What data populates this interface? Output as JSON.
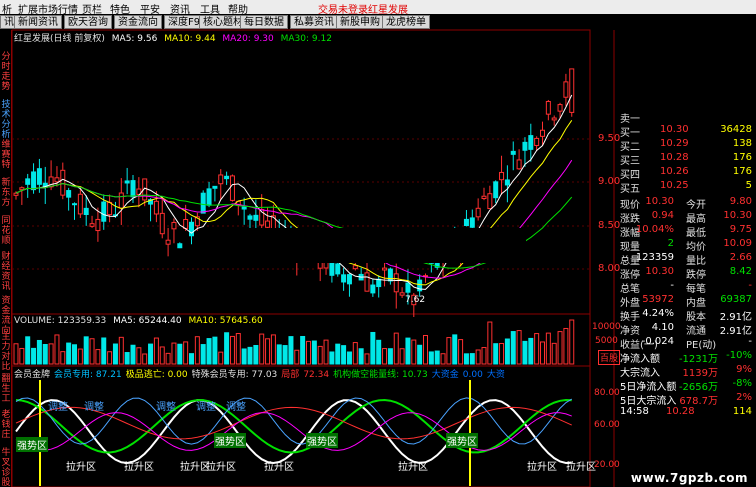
{
  "menubar": {
    "items": [
      "析",
      "扩展市场行情",
      "页栏",
      "特色",
      "平安",
      "资讯",
      "工具",
      "帮助"
    ],
    "right_items": [
      "交易未登录",
      "红星发展"
    ]
  },
  "tabs": [
    "讯",
    "新闻资讯",
    "欧天咨询",
    "资金流向",
    "深度F9",
    "核心题材",
    "每日数据",
    "私募资讯",
    "新股申购",
    "龙虎榜单"
  ],
  "sidebar": {
    "items": [
      "分时走势",
      "技术分析",
      "维赛特",
      "新东方",
      "同花顺",
      "财经资讯",
      "资金流向",
      "主力对比",
      "翻生工",
      "老钱庄",
      "牛叉诊股"
    ]
  },
  "kline": {
    "title": "红星发展(日线 前复权)",
    "ma5": "MA5: 9.56",
    "ma10": "MA10: 9.44",
    "ma20": "MA20: 9.30",
    "ma30": "MA30: 9.12",
    "low_label": "7.62",
    "axis": [
      "9.50",
      "9.00",
      "8.50",
      "8.00"
    ]
  },
  "volume": {
    "label": "VOLUME: 123359.33",
    "ma5": "MA5: 65244.40",
    "ma10": "MA10: 57645.60",
    "axis": [
      "10000",
      "5000"
    ],
    "unit": "百股"
  },
  "indicator": {
    "items": [
      {
        "text": "会员金牌",
        "color": "#e0e0e0"
      },
      {
        "text": "会员专用: 87.21",
        "color": "#00c0ff"
      },
      {
        "text": "极品逃亡: 0.00",
        "color": "#ffff00"
      },
      {
        "text": "特殊会员专用: 77.03",
        "color": "#e0e0e0"
      },
      {
        "text": "局部",
        "color": "#ff3030"
      },
      {
        "text": "72.34",
        "color": "#ff3030"
      },
      {
        "text": "机构做空能量线: 10.73",
        "color": "#00e000"
      },
      {
        "text": "大资金",
        "color": "#0070ff"
      },
      {
        "text": "0.00",
        "color": "#0070ff"
      },
      {
        "text": "大资",
        "color": "#0070ff"
      }
    ],
    "axis": [
      "80.00",
      "60.00",
      "20.00"
    ],
    "labels_lashen": "拉升区",
    "labels_qiangshi": "强势区",
    "labels_tiaozheng": "调整"
  },
  "quote": {
    "rows": [
      {
        "label": "卖一",
        "price": "",
        "vol": ""
      },
      {
        "label": "买一",
        "price": "10.30",
        "vol": "36428"
      },
      {
        "label": "买二",
        "price": "10.29",
        "vol": "138"
      },
      {
        "label": "买三",
        "price": "10.28",
        "vol": "176"
      },
      {
        "label": "买四",
        "price": "10.26",
        "vol": "176"
      },
      {
        "label": "买五",
        "price": "10.25",
        "vol": "5"
      }
    ],
    "stats": [
      [
        "现价",
        "10.30",
        "今开",
        "9.80"
      ],
      [
        "涨跌",
        "0.94",
        "最高",
        "10.30"
      ],
      [
        "涨幅",
        "10.04%",
        "最低",
        "9.75"
      ],
      [
        "现量",
        "2",
        "均价",
        "10.09"
      ],
      [
        "总量",
        "123359",
        "量比",
        "2.66"
      ],
      [
        "涨停",
        "10.30",
        "跌停",
        "8.42"
      ],
      [
        "总笔",
        "-",
        "每笔",
        "-"
      ],
      [
        "外盘",
        "53972",
        "内盘",
        "69387"
      ],
      [
        "换手",
        "4.24%",
        "股本",
        "2.91亿"
      ],
      [
        "净资",
        "4.10",
        "流通",
        "2.91亿"
      ],
      [
        "收益(一)",
        "-0.024",
        "PE(动)",
        "-"
      ]
    ],
    "flows": [
      [
        "净流入额",
        "-1231万",
        "-10%"
      ],
      [
        "大宗流入",
        "1139万",
        "9%"
      ],
      [
        "5日净流入额",
        "-2656万",
        "-8%"
      ],
      [
        "5日大宗流入",
        "678.7万",
        "2%"
      ]
    ],
    "last_time": "14:58",
    "last_price": "10.28",
    "last_vol": "114"
  },
  "watermark": "www.7gpzb.com"
}
